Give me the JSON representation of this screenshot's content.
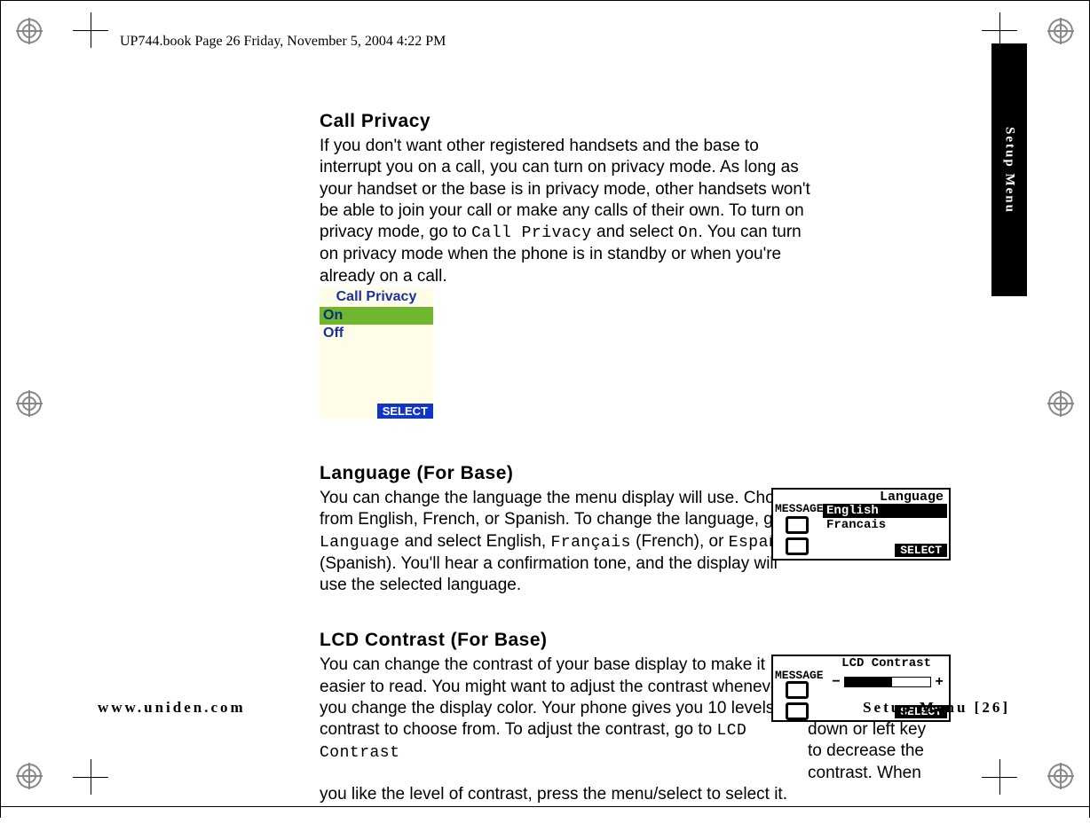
{
  "doc_header": "UP744.book  Page 26  Friday, November 5, 2004  4:22 PM",
  "side_tab": "Setup Menu",
  "sections": {
    "privacy": {
      "heading": "Call Privacy",
      "body_a": "If you don't want other registered handsets and the base to interrupt you on a call, you can turn on privacy mode. As long as your handset or the base is in privacy mode, other handsets won't be able to join your call or make any calls of their own. To turn on privacy mode, go to ",
      "menu1": "Call Privacy",
      "body_b": " and select ",
      "menu2": "On",
      "body_c": ". You can turn on privacy mode when the phone is in standby or when you're already on a call.",
      "screen": {
        "title": "Call Privacy",
        "opt_on": "On",
        "opt_off": "Off",
        "select": "SELECT"
      }
    },
    "language": {
      "heading": "Language (For Base)",
      "body_a": "You can change the language the menu display will use. Choose from English, French, or Spanish. To change the language, go to ",
      "menu1": "Language",
      "body_b": " and select English, ",
      "menu2": "Français",
      "body_c": " (French), or ",
      "menu3": "Español",
      "body_d": " (Spanish). You'll hear a confirmation tone, and the display will use the selected language.",
      "screen": {
        "title": "Language",
        "msg_label": "MESSAGE",
        "opt_sel": "English",
        "opt2": "Francais",
        "select": "SELECT"
      }
    },
    "contrast": {
      "heading": "LCD Contrast (For Base)",
      "body_a": "You can change the contrast of your base display to make it easier to read. You might want to adjust the contrast whenever you change the display color. Your phone gives you 10 levels of contrast to choose from. To adjust the contrast, go to ",
      "menu1": "LCD Contrast",
      "body_b": ". Use up or right key to increase the contrast and down or left key to decrease the contrast. When you like the level of contrast, press the menu/select to select it.",
      "screen": {
        "title": "LCD Contrast",
        "msg_label": "MESSAGE",
        "minus": "−",
        "plus": "+",
        "select": "SELECT"
      }
    }
  },
  "footer": {
    "left": "www.uniden.com",
    "right": "Setup Menu [26]"
  }
}
